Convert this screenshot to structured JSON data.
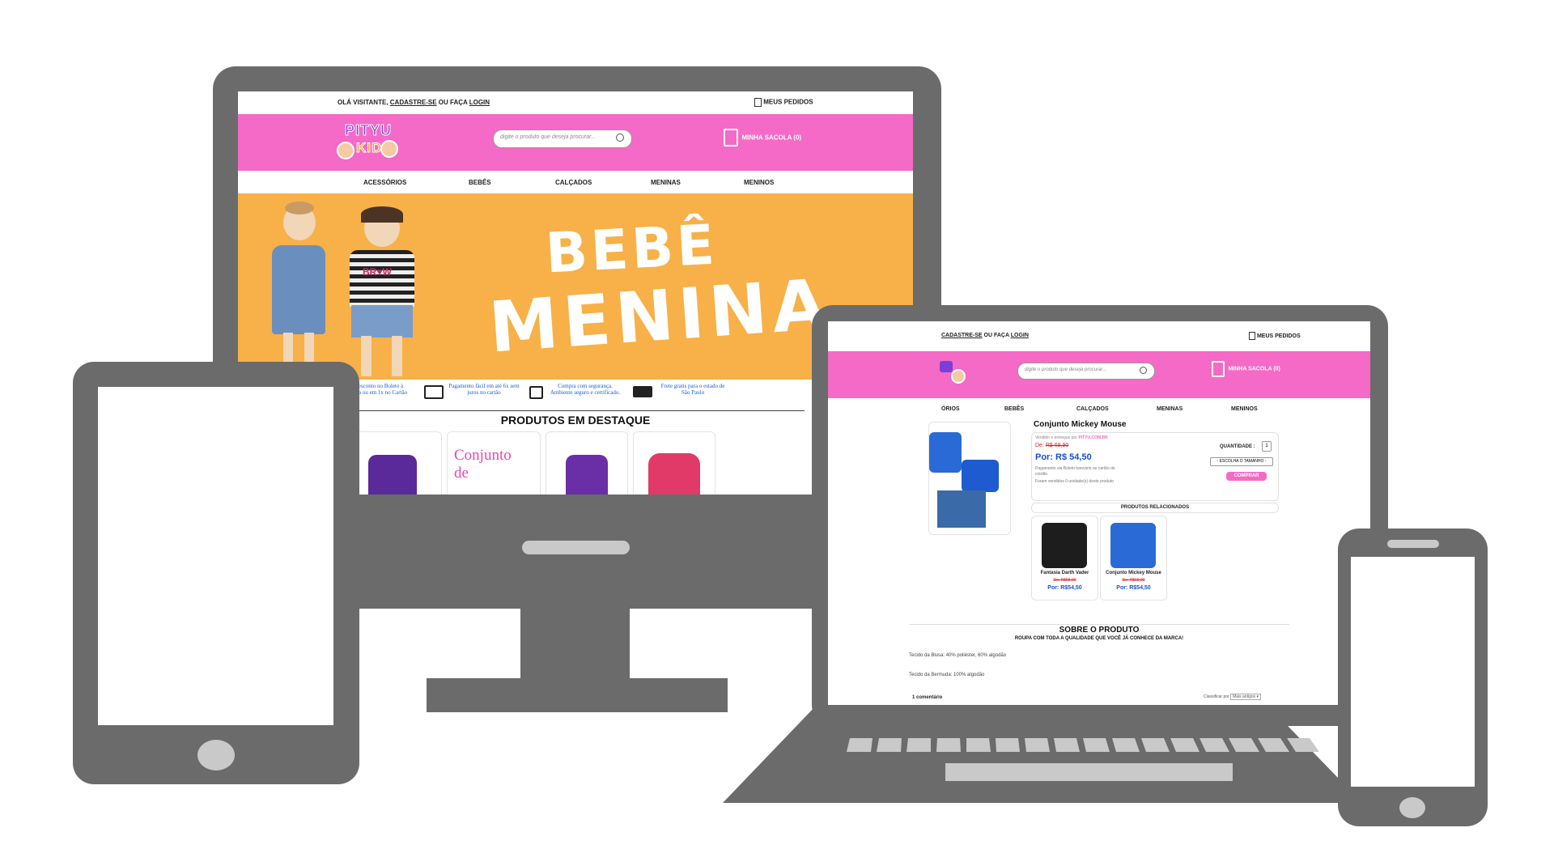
{
  "desktop": {
    "topbar": {
      "greeting": "OLÁ VISITANTE,",
      "signup": "CADASTRE-SE",
      "or_text": "OU FAÇA",
      "login": "LOGIN",
      "orders": "MEUS PEDIDOS"
    },
    "header": {
      "logo_top": "PITYU",
      "logo_bottom": "KIDS",
      "search_placeholder": "digite o produto que deseja procurar...",
      "bag": "MINHA SACOLA (0)"
    },
    "nav": [
      "ACESSÓRIOS",
      "BEBÊS",
      "CALÇADOS",
      "MENINAS",
      "MENINOS"
    ],
    "banner": {
      "line1": "BEBÊ",
      "line2": "MENINA",
      "shirt_text": "BR♥W"
    },
    "features": [
      {
        "icon": "barcode-icon",
        "text": "Desconto no Boleto à vista ou em 1x no Cartão"
      },
      {
        "icon": "credit-card-icon",
        "text": "Pagamento fácil em até 6x sem juros no cartão"
      },
      {
        "icon": "padlock-icon",
        "text": "Compra com segurança. Ambiente seguro e certificado."
      },
      {
        "icon": "delivery-truck-icon",
        "text": "Frete gratis para o estado de São Paulo"
      }
    ],
    "featured_title": "PRODUTOS EM DESTAQUE",
    "featured_promo": "Conjunto de"
  },
  "laptop": {
    "topbar": {
      "signup": "CADASTRE-SE",
      "or_text": "OU FAÇA",
      "login": "LOGIN",
      "orders": "MEUS PEDIDOS"
    },
    "header": {
      "search_placeholder": "digite o produto que deseja procurar...",
      "bag": "MINHA SACOLA (0)"
    },
    "nav": [
      "ÓRIOS",
      "BEBÊS",
      "CALÇADOS",
      "MENINAS",
      "MENINOS"
    ],
    "product": {
      "title": "Conjunto Mickey Mouse",
      "sold_by_prefix": "Vendido e entregue por",
      "seller": "PITYU.COM.BR",
      "old_price_label": "De:",
      "old_price": "R$ 69,90",
      "price": "Por: R$ 54,50",
      "payment_note": "Pagamento via Boleto bancário ou cartão de crédito",
      "sold_count": "Foram vendidos 0 unidade(s) deste produto",
      "quantity_label": "QUANTIDADE :",
      "quantity_value": "1",
      "size_select": "- ESCOLHA O TAMANHO -",
      "buy_button": "COMPRAR"
    },
    "related_title": "PRODUTOS RELACIONADOS",
    "related": [
      {
        "name": "Fantasia Darth Vader",
        "old": "De: R$58,90",
        "price": "Por: R$54,50"
      },
      {
        "name": "Conjunto Mickey Mouse",
        "old": "De: R$69,90",
        "price": "Por: R$54,50"
      }
    ],
    "about": {
      "title": "SOBRE O PRODUTO",
      "subtitle": "ROUPA COM TODA A QUALIDADE QUE VOCÊ JÁ CONHECE DA MARCA!",
      "line1": "Tecido da Blusa: 40% poliéster, 60% algodão",
      "line2": "Tecido da Bermuda: 100% algodão"
    },
    "comments": {
      "count": "1 comentário",
      "sort_label": "Classificar por",
      "sort_value": "Mais antigos ▾"
    }
  },
  "colors": {
    "device_gray": "#6b6b6b",
    "brand_pink": "#f46ac6",
    "banner_orange": "#f7b148",
    "price_blue": "#1a4fd1",
    "old_price_red": "#e02222"
  }
}
